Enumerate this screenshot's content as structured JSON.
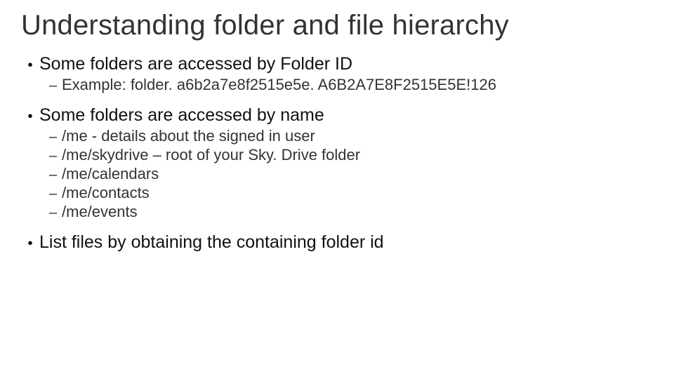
{
  "title": "Understanding folder and file hierarchy",
  "bullets": {
    "b1": {
      "text": "Some folders are accessed by Folder ID",
      "sub": [
        "Example: folder. a6b2a7e8f2515e5e. A6B2A7E8F2515E5E!126"
      ]
    },
    "b2": {
      "text": "Some folders are accessed by name",
      "sub": [
        "/me - details about the signed in user",
        "/me/skydrive – root of your Sky. Drive folder",
        "/me/calendars",
        "/me/contacts",
        "/me/events"
      ]
    },
    "b3": {
      "text": "List files by obtaining the containing folder id",
      "sub": []
    }
  }
}
